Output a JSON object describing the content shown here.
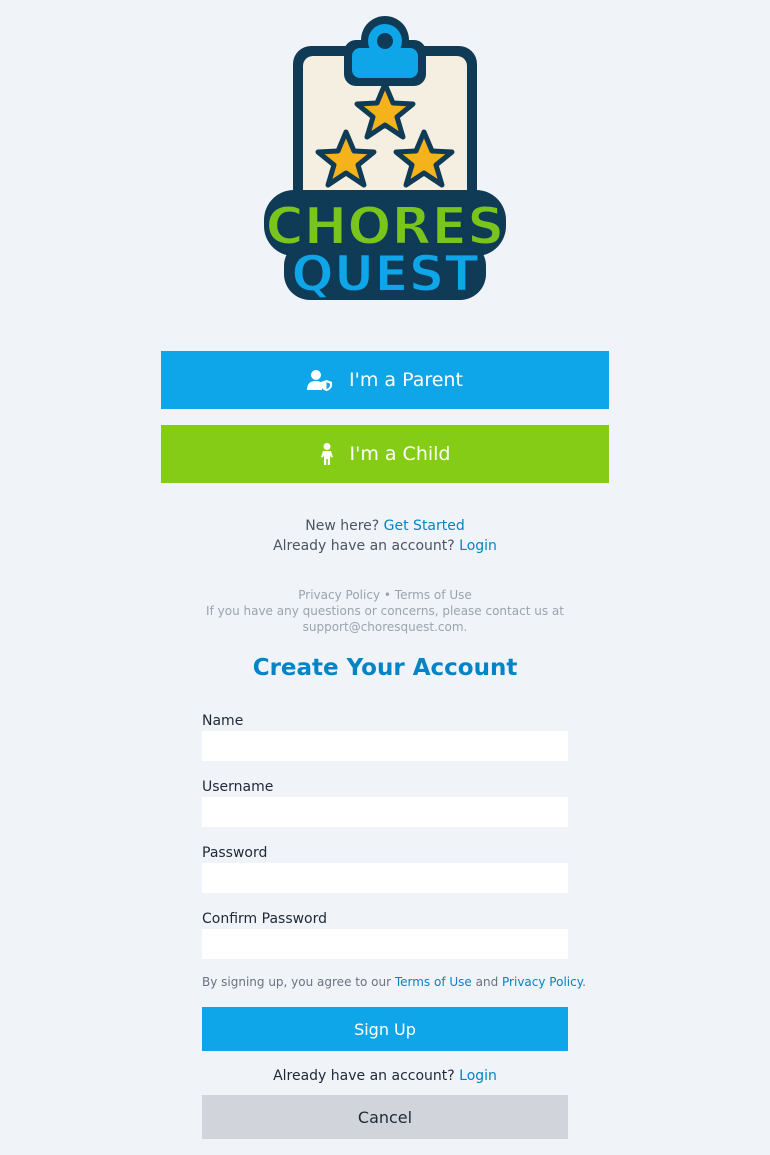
{
  "logo": {
    "line1": "CHORES",
    "line2": "QUEST",
    "colors": {
      "outline": "#0f3b57",
      "board": "#f4efe1",
      "clip": "#0ea5e9",
      "star": "#f5b21b",
      "chores": "#7ac51b",
      "quest": "#0ea5e9"
    }
  },
  "roles": {
    "parent_label": "I'm a Parent",
    "parent_icon": "user-shield-icon",
    "child_label": "I'm a Child",
    "child_icon": "child-icon"
  },
  "auth": {
    "new_here_text": "New here?",
    "get_started_link": "Get Started",
    "have_account_text": "Already have an account?",
    "login_link": "Login"
  },
  "legal": {
    "privacy_link": "Privacy Policy",
    "separator": "•",
    "terms_link": "Terms of Use",
    "contact_text": "If you have any questions or concerns, please contact us at support@choresquest.com."
  },
  "signup_form": {
    "title": "Create Your Account",
    "name_label": "Name",
    "name_value": "",
    "username_label": "Username",
    "username_value": "",
    "password_label": "Password",
    "password_value": "",
    "confirm_label": "Confirm Password",
    "confirm_value": "",
    "agree_prefix": "By signing up, you agree to our",
    "agree_terms_link": "Terms of Use",
    "agree_and": "and",
    "agree_privacy_link": "Privacy Policy",
    "agree_suffix": ".",
    "submit_label": "Sign Up",
    "have_account_text": "Already have an account?",
    "login_link": "Login",
    "cancel_label": "Cancel"
  },
  "colors": {
    "background": "#f0f3f7",
    "primary": "#0ea5e9",
    "child_green": "#84cc16",
    "link": "#0284c7",
    "cancel_gray": "#d1d5db"
  }
}
